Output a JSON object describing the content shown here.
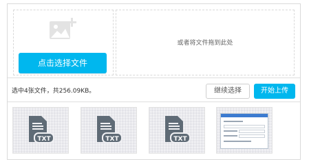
{
  "picker": {
    "button_label": "点击选择文件",
    "icon": "image-add-icon"
  },
  "dropzone": {
    "hint": "或者将文件拖到此处"
  },
  "status": {
    "summary": "选中4张文件，共256.09KB。",
    "continue_label": "继续选择",
    "start_label": "开始上传"
  },
  "files": [
    {
      "type": "txt",
      "badge": "TXT",
      "icon": "txt-file-icon"
    },
    {
      "type": "txt",
      "badge": "TXT",
      "icon": "txt-file-icon"
    },
    {
      "type": "txt",
      "badge": "TXT",
      "icon": "txt-file-icon"
    },
    {
      "type": "image",
      "icon": "screenshot-thumbnail"
    }
  ],
  "colors": {
    "accent": "#00b7ee",
    "icon_gray": "#5f6b76"
  }
}
